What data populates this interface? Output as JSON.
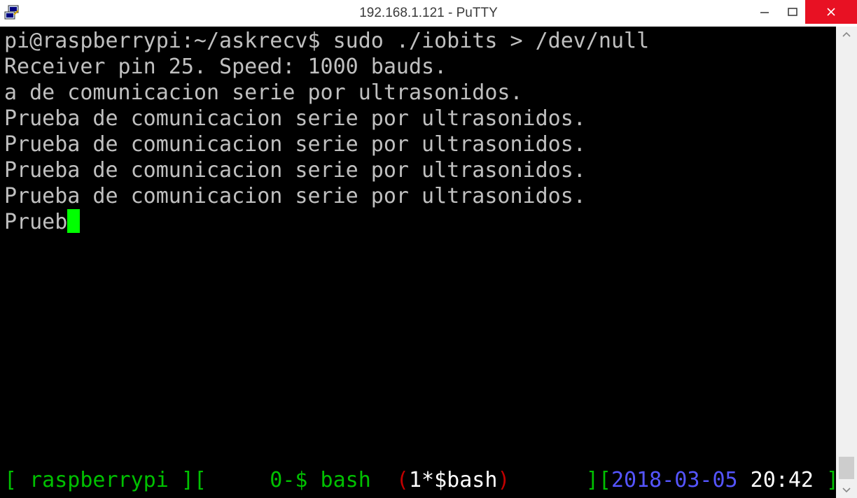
{
  "window": {
    "title": "192.168.1.121 - PuTTY",
    "icons": {
      "app": "putty-icon",
      "minimize": "minimize-icon",
      "maximize": "maximize-icon",
      "close": "close-icon"
    }
  },
  "terminal": {
    "lines": [
      "pi@raspberrypi:~/askrecv$ sudo ./iobits > /dev/null",
      "Receiver pin 25. Speed: 1000 bauds.",
      "a de comunicacion serie por ultrasonidos.",
      "Prueba de comunicacion serie por ultrasonidos.",
      "Prueba de comunicacion serie por ultrasonidos.",
      "Prueba de comunicacion serie por ultrasonidos.",
      "Prueba de comunicacion serie por ultrasonidos.",
      "Prueb"
    ],
    "cursor_color": "#00ff00"
  },
  "screen_status": {
    "host_seg": "[ raspberrypi ][     ",
    "window0": "0-$ bash  ",
    "paren_open": "(",
    "window1": "1*$bash",
    "paren_close": ")",
    "gap": "      ][",
    "date": "2018-03-05",
    "time": " 20:42",
    "end": " ]"
  },
  "colors": {
    "green": "#00c000",
    "red": "#c00000",
    "blue": "#5555ff",
    "close_button": "#e81123"
  }
}
